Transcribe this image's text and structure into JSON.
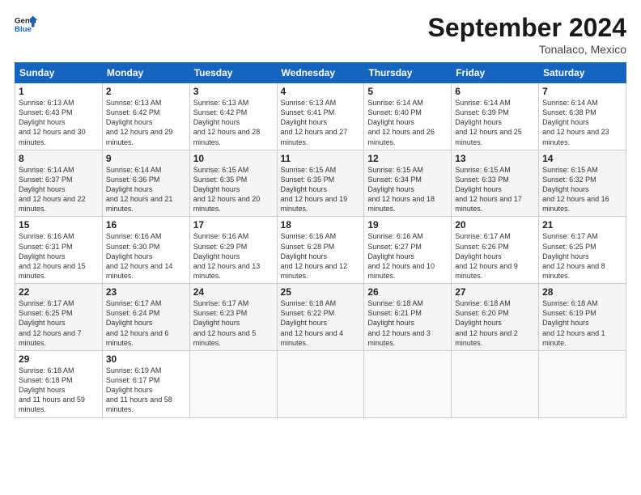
{
  "logo": {
    "line1": "General",
    "line2": "Blue"
  },
  "title": "September 2024",
  "location": "Tonalaco, Mexico",
  "days_header": [
    "Sunday",
    "Monday",
    "Tuesday",
    "Wednesday",
    "Thursday",
    "Friday",
    "Saturday"
  ],
  "weeks": [
    [
      {
        "day": "1",
        "rise": "6:13 AM",
        "set": "6:43 PM",
        "daylight": "12 hours and 30 minutes."
      },
      {
        "day": "2",
        "rise": "6:13 AM",
        "set": "6:42 PM",
        "daylight": "12 hours and 29 minutes."
      },
      {
        "day": "3",
        "rise": "6:13 AM",
        "set": "6:42 PM",
        "daylight": "12 hours and 28 minutes."
      },
      {
        "day": "4",
        "rise": "6:13 AM",
        "set": "6:41 PM",
        "daylight": "12 hours and 27 minutes."
      },
      {
        "day": "5",
        "rise": "6:14 AM",
        "set": "6:40 PM",
        "daylight": "12 hours and 26 minutes."
      },
      {
        "day": "6",
        "rise": "6:14 AM",
        "set": "6:39 PM",
        "daylight": "12 hours and 25 minutes."
      },
      {
        "day": "7",
        "rise": "6:14 AM",
        "set": "6:38 PM",
        "daylight": "12 hours and 23 minutes."
      }
    ],
    [
      {
        "day": "8",
        "rise": "6:14 AM",
        "set": "6:37 PM",
        "daylight": "12 hours and 22 minutes."
      },
      {
        "day": "9",
        "rise": "6:14 AM",
        "set": "6:36 PM",
        "daylight": "12 hours and 21 minutes."
      },
      {
        "day": "10",
        "rise": "6:15 AM",
        "set": "6:35 PM",
        "daylight": "12 hours and 20 minutes."
      },
      {
        "day": "11",
        "rise": "6:15 AM",
        "set": "6:35 PM",
        "daylight": "12 hours and 19 minutes."
      },
      {
        "day": "12",
        "rise": "6:15 AM",
        "set": "6:34 PM",
        "daylight": "12 hours and 18 minutes."
      },
      {
        "day": "13",
        "rise": "6:15 AM",
        "set": "6:33 PM",
        "daylight": "12 hours and 17 minutes."
      },
      {
        "day": "14",
        "rise": "6:15 AM",
        "set": "6:32 PM",
        "daylight": "12 hours and 16 minutes."
      }
    ],
    [
      {
        "day": "15",
        "rise": "6:16 AM",
        "set": "6:31 PM",
        "daylight": "12 hours and 15 minutes."
      },
      {
        "day": "16",
        "rise": "6:16 AM",
        "set": "6:30 PM",
        "daylight": "12 hours and 14 minutes."
      },
      {
        "day": "17",
        "rise": "6:16 AM",
        "set": "6:29 PM",
        "daylight": "12 hours and 13 minutes."
      },
      {
        "day": "18",
        "rise": "6:16 AM",
        "set": "6:28 PM",
        "daylight": "12 hours and 12 minutes."
      },
      {
        "day": "19",
        "rise": "6:16 AM",
        "set": "6:27 PM",
        "daylight": "12 hours and 10 minutes."
      },
      {
        "day": "20",
        "rise": "6:17 AM",
        "set": "6:26 PM",
        "daylight": "12 hours and 9 minutes."
      },
      {
        "day": "21",
        "rise": "6:17 AM",
        "set": "6:25 PM",
        "daylight": "12 hours and 8 minutes."
      }
    ],
    [
      {
        "day": "22",
        "rise": "6:17 AM",
        "set": "6:25 PM",
        "daylight": "12 hours and 7 minutes."
      },
      {
        "day": "23",
        "rise": "6:17 AM",
        "set": "6:24 PM",
        "daylight": "12 hours and 6 minutes."
      },
      {
        "day": "24",
        "rise": "6:17 AM",
        "set": "6:23 PM",
        "daylight": "12 hours and 5 minutes."
      },
      {
        "day": "25",
        "rise": "6:18 AM",
        "set": "6:22 PM",
        "daylight": "12 hours and 4 minutes."
      },
      {
        "day": "26",
        "rise": "6:18 AM",
        "set": "6:21 PM",
        "daylight": "12 hours and 3 minutes."
      },
      {
        "day": "27",
        "rise": "6:18 AM",
        "set": "6:20 PM",
        "daylight": "12 hours and 2 minutes."
      },
      {
        "day": "28",
        "rise": "6:18 AM",
        "set": "6:19 PM",
        "daylight": "12 hours and 1 minute."
      }
    ],
    [
      {
        "day": "29",
        "rise": "6:18 AM",
        "set": "6:18 PM",
        "daylight": "11 hours and 59 minutes."
      },
      {
        "day": "30",
        "rise": "6:19 AM",
        "set": "6:17 PM",
        "daylight": "11 hours and 58 minutes."
      },
      null,
      null,
      null,
      null,
      null
    ]
  ]
}
